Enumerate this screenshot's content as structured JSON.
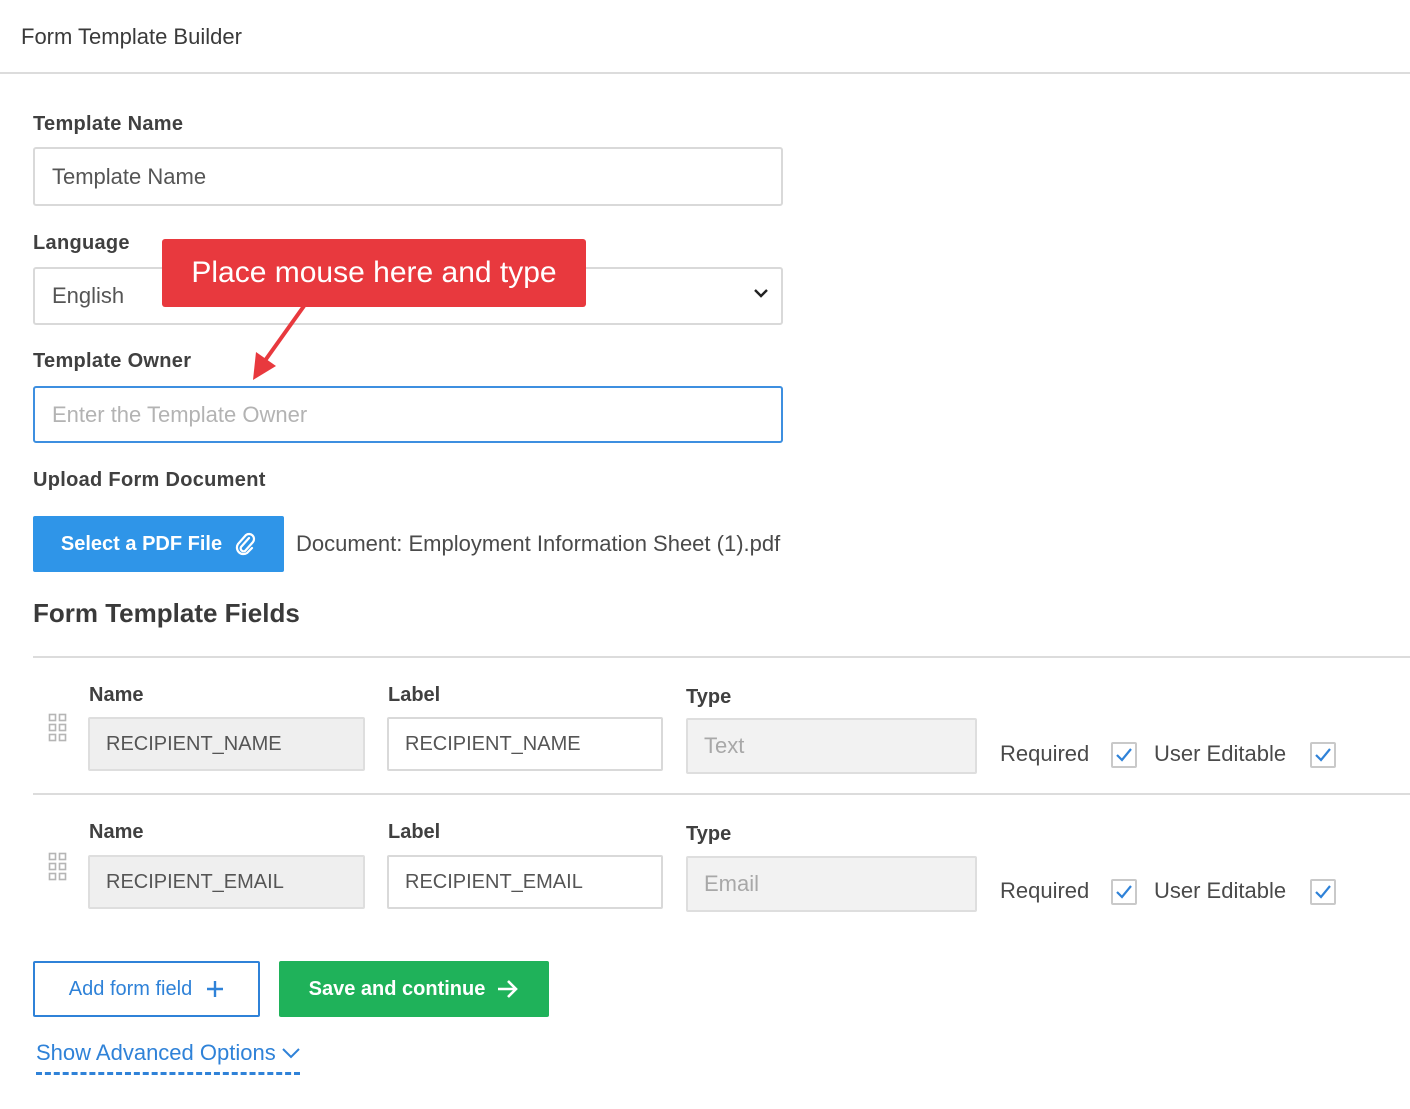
{
  "header": {
    "title": "Form Template Builder"
  },
  "form": {
    "template_name": {
      "label": "Template Name",
      "value": "Template Name"
    },
    "language": {
      "label": "Language",
      "value": "English"
    },
    "template_owner": {
      "label": "Template Owner",
      "placeholder": "Enter the Template Owner"
    },
    "upload": {
      "label": "Upload Form Document",
      "button": "Select a PDF File",
      "document": "Document: Employment Information Sheet (1).pdf"
    }
  },
  "callout": {
    "text": "Place mouse here and type",
    "color": "#e8393e"
  },
  "fields_section": {
    "title": "Form Template Fields",
    "column_labels": {
      "name": "Name",
      "label": "Label",
      "type": "Type"
    },
    "rows": [
      {
        "name": "RECIPIENT_NAME",
        "label": "RECIPIENT_NAME",
        "type": "Text",
        "required_label": "Required",
        "required": true,
        "editable_label": "User Editable",
        "editable": true
      },
      {
        "name": "RECIPIENT_EMAIL",
        "label": "RECIPIENT_EMAIL",
        "type": "Email",
        "required_label": "Required",
        "required": true,
        "editable_label": "User Editable",
        "editable": true
      }
    ]
  },
  "actions": {
    "add_field": "Add form field",
    "save": "Save and continue",
    "advanced": "Show Advanced Options"
  },
  "colors": {
    "primary": "#2f95e8",
    "link": "#2f82d8",
    "success": "#1fb25a",
    "focus": "#3d8fe0"
  }
}
